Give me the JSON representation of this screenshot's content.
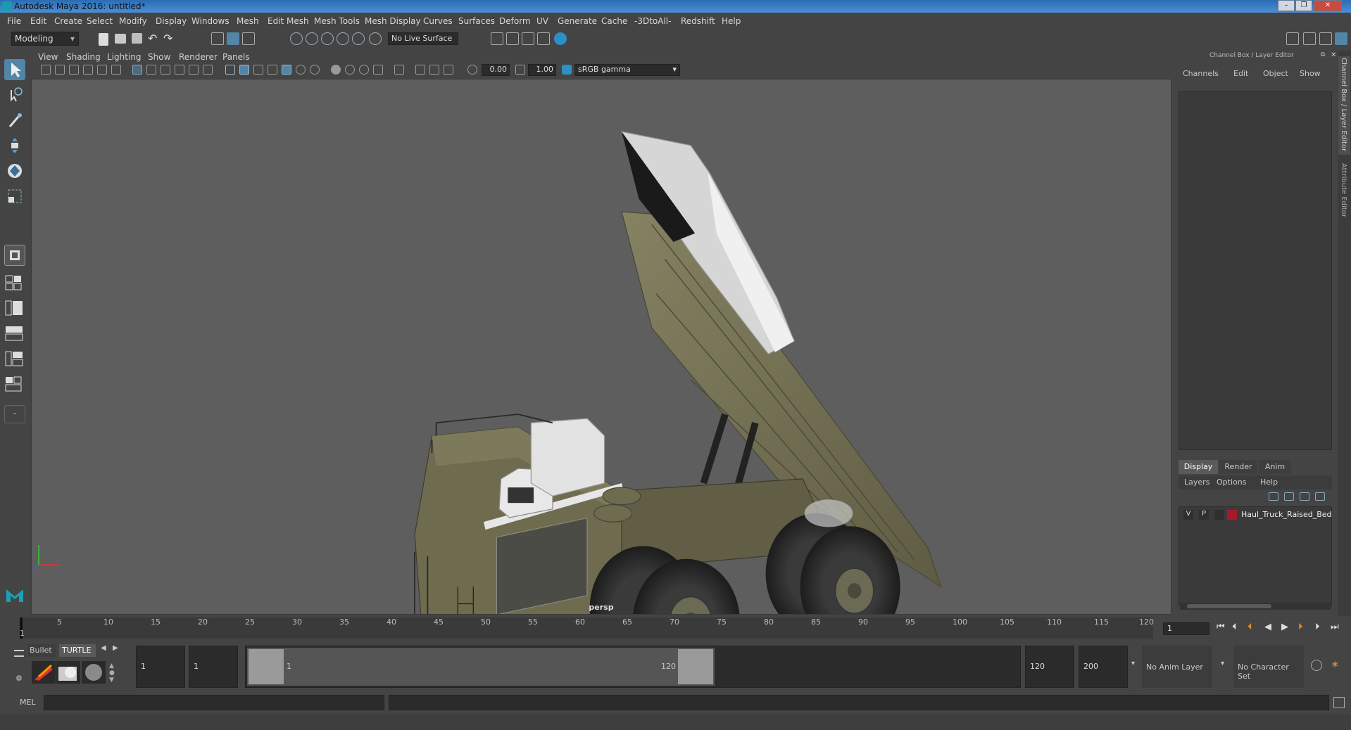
{
  "window": {
    "title": "Autodesk Maya 2016: untitled*"
  },
  "menubar": [
    "File",
    "Edit",
    "Create",
    "Select",
    "Modify",
    "Display",
    "Windows",
    "Mesh",
    "Edit Mesh",
    "Mesh Tools",
    "Mesh Display",
    "Curves",
    "Surfaces",
    "Deform",
    "UV",
    "Generate",
    "Cache",
    "-3DtoAll-",
    "Redshift",
    "Help"
  ],
  "statusline": {
    "menuset": "Modeling",
    "live_surface": "No Live Surface"
  },
  "viewport": {
    "menus": [
      "View",
      "Shading",
      "Lighting",
      "Show",
      "Renderer",
      "Panels"
    ],
    "exposure": "0.00",
    "gamma": "1.00",
    "color_space": "sRGB gamma",
    "camera_label": "persp"
  },
  "channel_box": {
    "title": "Channel Box / Layer Editor",
    "menus": [
      "Channels",
      "Edit",
      "Object",
      "Show"
    ],
    "side_tab_1": "Channel Box / Layer Editor",
    "side_tab_2": "Attribute Editor"
  },
  "layer_editor": {
    "tabs": [
      "Display",
      "Render",
      "Anim"
    ],
    "menus": [
      "Layers",
      "Options",
      "Help"
    ],
    "layers": [
      {
        "v": "V",
        "p": "P",
        "color": "#a8182b",
        "name": "Haul_Truck_Raised_Bed"
      }
    ]
  },
  "timeline": {
    "ticks": [
      "1",
      "5",
      "10",
      "15",
      "20",
      "25",
      "30",
      "35",
      "40",
      "45",
      "50",
      "55",
      "60",
      "65",
      "70",
      "75",
      "80",
      "85",
      "90",
      "95",
      "100",
      "105",
      "110",
      "115",
      "120"
    ],
    "current_frame": "1"
  },
  "shelf": {
    "tabs": [
      "Bullet",
      "TURTLE"
    ]
  },
  "range": {
    "start": "1",
    "playback_start": "1",
    "slider_start": "1",
    "slider_end": "120",
    "playback_end": "120",
    "end": "200",
    "anim_layer": "No Anim Layer",
    "character_set": "No Character Set"
  },
  "command": {
    "language": "MEL"
  },
  "colors": {
    "viewport_bg": "#5e5e5e",
    "ui_bg": "#444444",
    "field_bg": "#2b2b2b",
    "active_tool": "#5285a6",
    "truck_body": "#6e6b4f",
    "title_bar": "#2b6db5"
  }
}
